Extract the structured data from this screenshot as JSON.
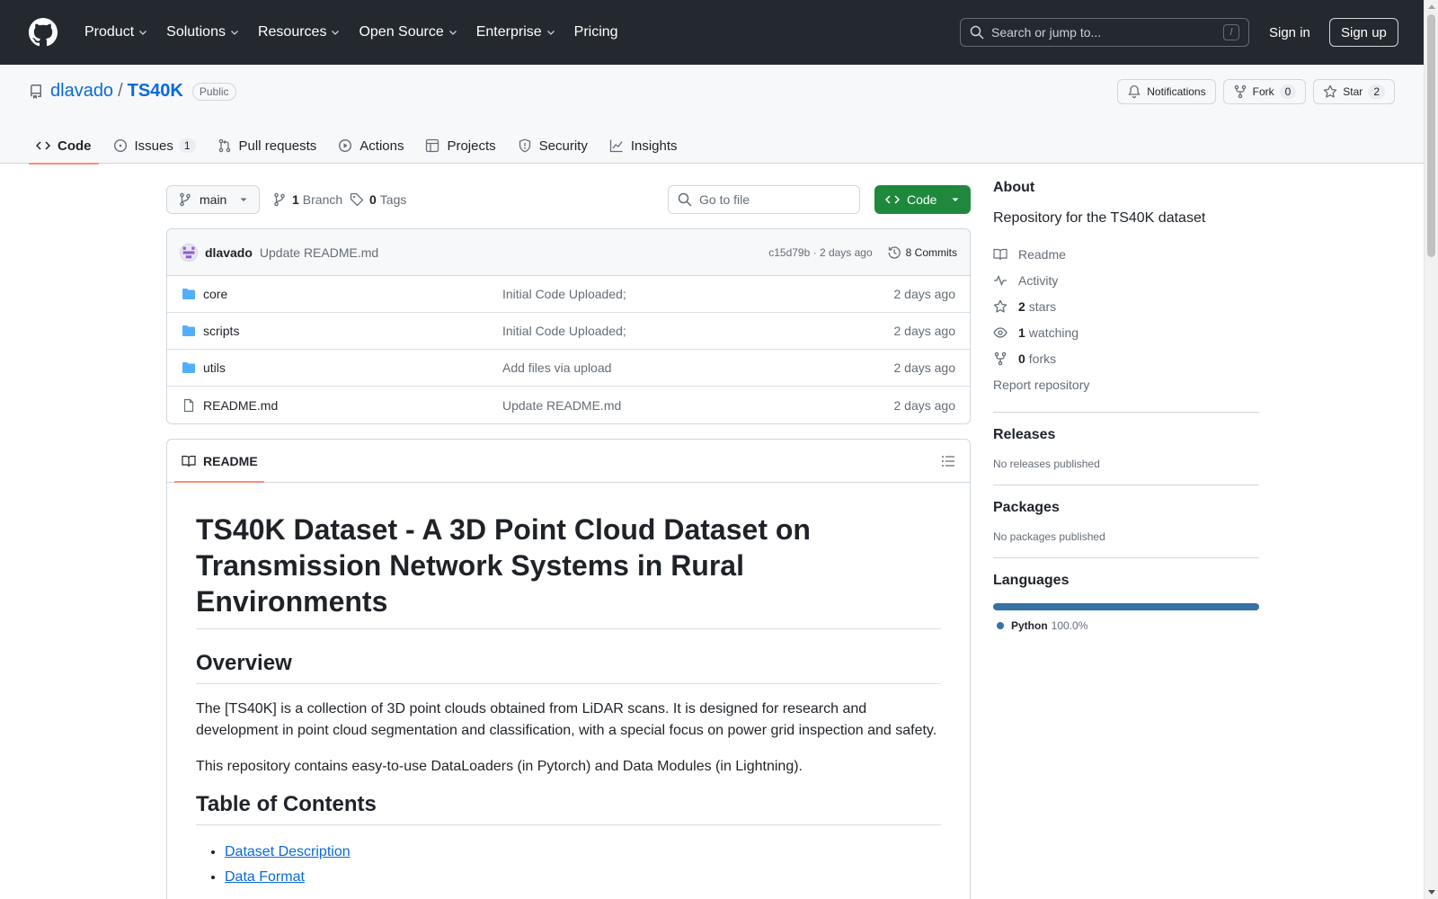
{
  "header": {
    "nav": [
      {
        "label": "Product",
        "dropdown": true
      },
      {
        "label": "Solutions",
        "dropdown": true
      },
      {
        "label": "Resources",
        "dropdown": true
      },
      {
        "label": "Open Source",
        "dropdown": true
      },
      {
        "label": "Enterprise",
        "dropdown": true
      },
      {
        "label": "Pricing",
        "dropdown": false
      }
    ],
    "search_placeholder": "Search or jump to...",
    "search_shortcut": "/",
    "sign_in": "Sign in",
    "sign_up": "Sign up"
  },
  "repo": {
    "owner": "dlavado",
    "separator": "/",
    "name": "TS40K",
    "visibility": "Public",
    "notifications_label": "Notifications",
    "fork_label": "Fork",
    "fork_count": "0",
    "star_label": "Star",
    "star_count": "2",
    "tabs": [
      {
        "label": "Code",
        "icon": "code-icon",
        "active": true,
        "count": ""
      },
      {
        "label": "Issues",
        "icon": "issue-icon",
        "active": false,
        "count": "1"
      },
      {
        "label": "Pull requests",
        "icon": "pull-request-icon",
        "active": false,
        "count": ""
      },
      {
        "label": "Actions",
        "icon": "play-icon",
        "active": false,
        "count": ""
      },
      {
        "label": "Projects",
        "icon": "table-icon",
        "active": false,
        "count": ""
      },
      {
        "label": "Security",
        "icon": "shield-icon",
        "active": false,
        "count": ""
      },
      {
        "label": "Insights",
        "icon": "graph-icon",
        "active": false,
        "count": ""
      }
    ]
  },
  "toolbar": {
    "branch": "main",
    "branch_count": "1",
    "branch_label": "Branch",
    "tag_count": "0",
    "tag_label": "Tags",
    "goto_placeholder": "Go to file",
    "code_button": "Code"
  },
  "commit": {
    "author": "dlavado",
    "message": "Update README.md",
    "hash_time": "c15d79b · 2 days ago",
    "commits_label": "8 Commits"
  },
  "files": [
    {
      "name": "core",
      "type": "dir",
      "message": "Initial Code Uploaded;",
      "date": "2 days ago"
    },
    {
      "name": "scripts",
      "type": "dir",
      "message": "Initial Code Uploaded;",
      "date": "2 days ago"
    },
    {
      "name": "utils",
      "type": "dir",
      "message": "Add files via upload",
      "date": "2 days ago"
    },
    {
      "name": "README.md",
      "type": "file",
      "message": "Update README.md",
      "date": "2 days ago"
    }
  ],
  "readme": {
    "tab_label": "README",
    "title": "TS40K Dataset - A 3D Point Cloud Dataset on Transmission Network Systems in Rural Environments",
    "overview_heading": "Overview",
    "overview_p1": "The [TS40K] is a collection of 3D point clouds obtained from LiDAR scans. It is designed for research and development in point cloud segmentation and classification, with a special focus on power grid inspection and safety.",
    "overview_p2": "This repository contains easy-to-use DataLoaders (in Pytorch) and Data Modules (in Lightning).",
    "toc_heading": "Table of Contents",
    "toc": [
      "Dataset Description",
      "Data Format"
    ]
  },
  "about": {
    "heading": "About",
    "description": "Repository for the TS40K dataset",
    "readme": "Readme",
    "activity": "Activity",
    "stars_count": "2",
    "stars_label": "stars",
    "watching_count": "1",
    "watching_label": "watching",
    "forks_count": "0",
    "forks_label": "forks",
    "report": "Report repository"
  },
  "releases": {
    "heading": "Releases",
    "empty": "No releases published"
  },
  "packages": {
    "heading": "Packages",
    "empty": "No packages published"
  },
  "languages": {
    "heading": "Languages",
    "items": [
      {
        "name": "Python",
        "percent": "100.0%",
        "fraction": 1.0,
        "color": "#3572A5"
      }
    ]
  }
}
